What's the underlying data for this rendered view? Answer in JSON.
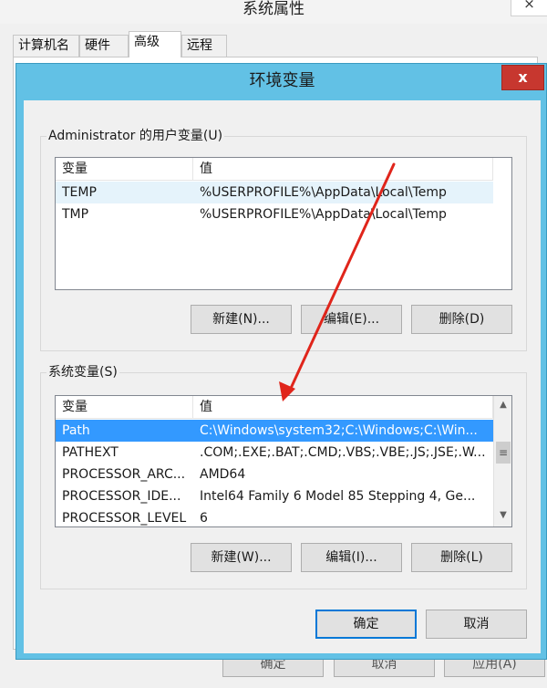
{
  "background_window": {
    "title": "系统属性",
    "close_glyph": "×",
    "tabs": [
      {
        "label": "计算机名",
        "active": false
      },
      {
        "label": "硬件",
        "active": false
      },
      {
        "label": "高级",
        "active": true
      },
      {
        "label": "远程",
        "active": false
      }
    ],
    "buttons": {
      "ok": "确定",
      "cancel": "取消",
      "apply": "应用(A)"
    }
  },
  "dialog": {
    "title": "环境变量",
    "close_glyph": "x",
    "user_vars": {
      "group_label": "Administrator 的用户变量(U)",
      "columns": [
        "变量",
        "值"
      ],
      "rows": [
        {
          "name": "TEMP",
          "value": "%USERPROFILE%\\AppData\\Local\\Temp"
        },
        {
          "name": "TMP",
          "value": "%USERPROFILE%\\AppData\\Local\\Temp"
        }
      ],
      "buttons": {
        "new": "新建(N)...",
        "edit": "编辑(E)...",
        "delete": "删除(D)"
      }
    },
    "system_vars": {
      "group_label": "系统变量(S)",
      "columns": [
        "变量",
        "值"
      ],
      "rows": [
        {
          "name": "Path",
          "value": "C:\\Windows\\system32;C:\\Windows;C:\\Win...",
          "selected": true
        },
        {
          "name": "PATHEXT",
          "value": ".COM;.EXE;.BAT;.CMD;.VBS;.VBE;.JS;.JSE;.W..."
        },
        {
          "name": "PROCESSOR_ARC...",
          "value": "AMD64"
        },
        {
          "name": "PROCESSOR_IDE...",
          "value": "Intel64 Family 6 Model 85 Stepping 4, Ge..."
        },
        {
          "name": "PROCESSOR_LEVEL",
          "value": "6"
        }
      ],
      "buttons": {
        "new": "新建(W)...",
        "edit": "编辑(I)...",
        "delete": "删除(L)"
      }
    },
    "footer": {
      "ok": "确定",
      "cancel": "取消"
    }
  },
  "annotation": {
    "arrow_color": "#e0251b"
  },
  "colors": {
    "dialog_frame": "#62c1e5",
    "selection": "#3399ff",
    "close_button": "#c7372f"
  }
}
